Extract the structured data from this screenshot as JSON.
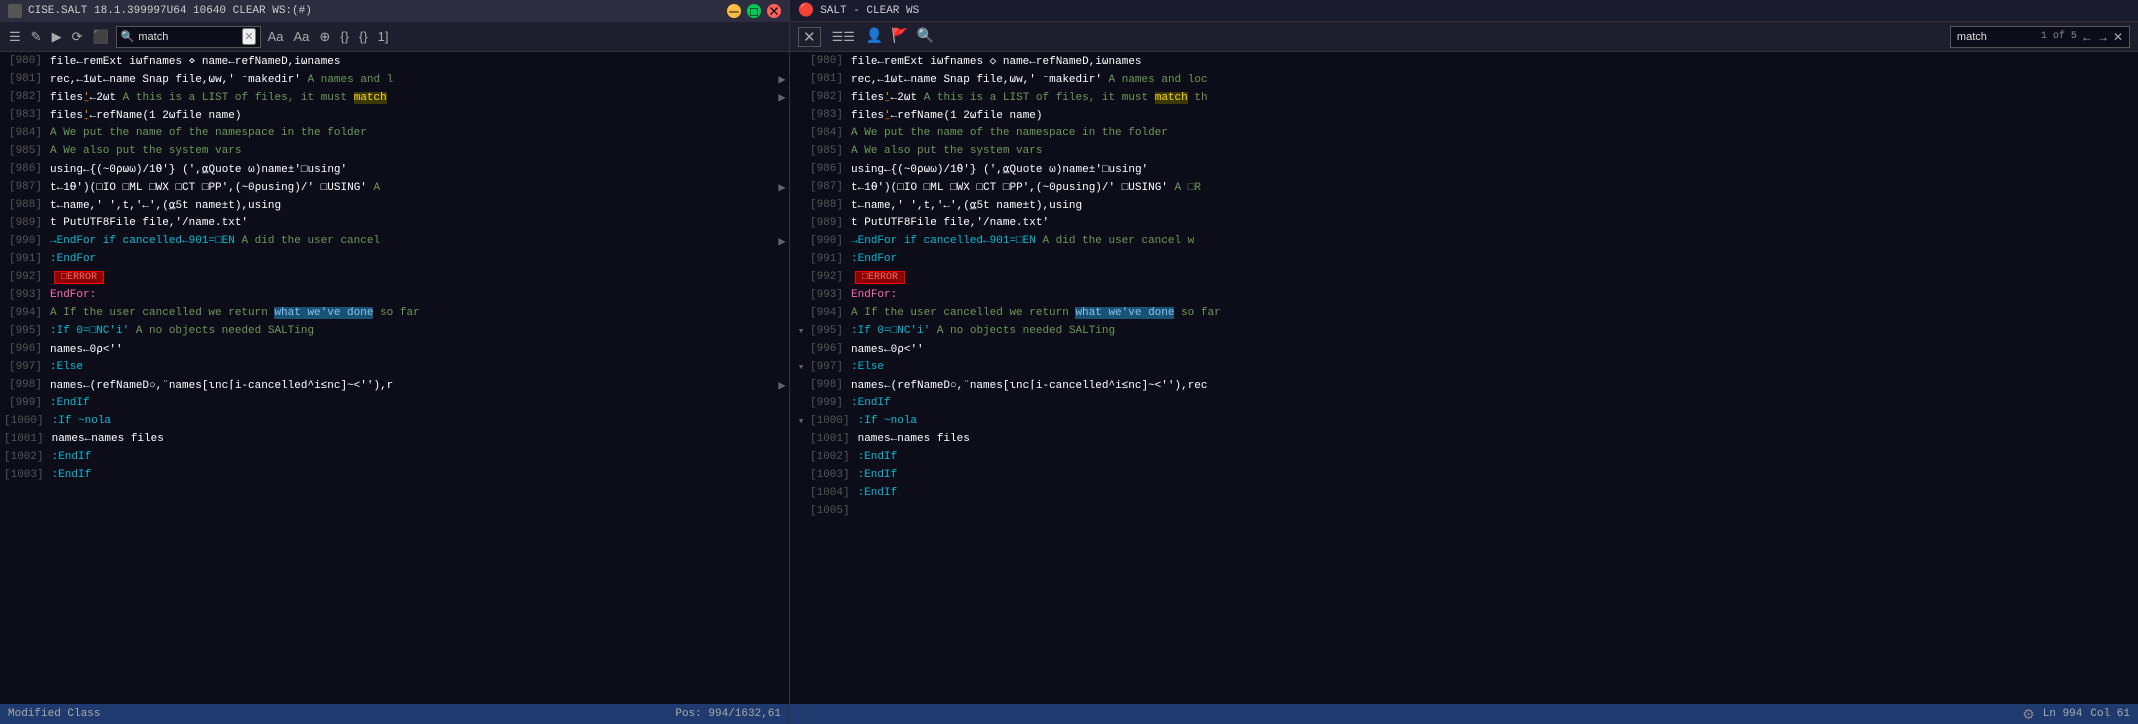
{
  "left": {
    "title": "CISE.SALT 18.1.399997U64 10640 CLEAR WS:(#)",
    "search_value": "match",
    "status_left": "Modified Class",
    "status_right": "Pos: 994/1632,61",
    "lines": [
      {
        "num": "980",
        "content": [
          {
            "t": "        file←remExt i⍵fnames ⋄ name←refNameD,i⍵names",
            "c": "kw-white"
          }
        ],
        "arrow": ""
      },
      {
        "num": "981",
        "content": [
          {
            "t": "        rec,←1⍵t←name Snap file,⍵w,' ⁻makedir' ",
            "c": "kw-white"
          },
          {
            "t": "A names and l",
            "c": "kw-comment"
          }
        ],
        "arrow": "▶"
      },
      {
        "num": "982",
        "content": [
          {
            "t": "        files",
            "c": "kw-white"
          },
          {
            "t": "⍘",
            "c": "kw-orange"
          },
          {
            "t": "←2⍵t ",
            "c": "kw-white"
          },
          {
            "t": "A this is a LIST of files, it must ",
            "c": "kw-comment"
          },
          {
            "t": "match",
            "c": "highlight-match"
          }
        ],
        "arrow": "▶"
      },
      {
        "num": "983",
        "content": [
          {
            "t": "        files",
            "c": "kw-white"
          },
          {
            "t": "⍘",
            "c": "kw-orange"
          },
          {
            "t": "←refName(1 2⍵file name)",
            "c": "kw-white"
          }
        ],
        "arrow": ""
      },
      {
        "num": "984",
        "content": [
          {
            "t": "        ",
            "c": "kw-white"
          },
          {
            "t": "A We put the name of the namespace in the folder",
            "c": "kw-comment"
          }
        ],
        "arrow": ""
      },
      {
        "num": "985",
        "content": [
          {
            "t": "        ",
            "c": "kw-white"
          },
          {
            "t": "A We also put the system vars",
            "c": "kw-comment"
          }
        ],
        "arrow": ""
      },
      {
        "num": "986",
        "content": [
          {
            "t": "        using←{(~0⍴⍵ω)/1⍬'} (',⍶Quote ω)name±'□using'",
            "c": "kw-white"
          }
        ],
        "arrow": ""
      },
      {
        "num": "987",
        "content": [
          {
            "t": "        t←1⍬')(□IO □ML □WX □CT □PP',(~0⍴using)/' □USING' ",
            "c": "kw-white"
          },
          {
            "t": "A ",
            "c": "kw-comment"
          }
        ],
        "arrow": "▶"
      },
      {
        "num": "988",
        "content": [
          {
            "t": "        t←name,' ',t,'←',(⍶5t name±t),using",
            "c": "kw-white"
          }
        ],
        "arrow": ""
      },
      {
        "num": "989",
        "content": [
          {
            "t": "        t PutUTF8File file,'/name.txt'",
            "c": "kw-white"
          }
        ],
        "arrow": ""
      },
      {
        "num": "990",
        "content": [
          {
            "t": "        ",
            "c": "kw-white"
          },
          {
            "t": "→EndFor if cancelled←901=□EN   ",
            "c": "kw-cyan"
          },
          {
            "t": "A did the user cancel ",
            "c": "kw-comment"
          }
        ],
        "arrow": "▶"
      },
      {
        "num": "991",
        "content": [
          {
            "t": "        :EndFor",
            "c": "kw-cyan"
          }
        ],
        "arrow": ""
      },
      {
        "num": "992",
        "content": [
          {
            "t": "        ",
            "c": "kw-white"
          },
          {
            "t": "□ERROR",
            "c": "error-badge"
          }
        ],
        "arrow": ""
      },
      {
        "num": "993",
        "content": [
          {
            "t": "    EndFor:",
            "c": "kw-pink"
          }
        ],
        "arrow": ""
      },
      {
        "num": "994",
        "content": [
          {
            "t": "        ",
            "c": "kw-white"
          },
          {
            "t": "A If the user cancelled we return ",
            "c": "kw-comment"
          },
          {
            "t": "what we've done",
            "c": "highlight-blue"
          },
          {
            "t": " so far",
            "c": "kw-comment"
          }
        ],
        "arrow": ""
      },
      {
        "num": "995",
        "content": [
          {
            "t": "        :If 0=□NC'i' ",
            "c": "kw-cyan"
          },
          {
            "t": "A no objects needed SALTing",
            "c": "kw-comment"
          }
        ],
        "arrow": ""
      },
      {
        "num": "996",
        "content": [
          {
            "t": "            names←0⍴<''",
            "c": "kw-white"
          }
        ],
        "arrow": ""
      },
      {
        "num": "997",
        "content": [
          {
            "t": "        :Else",
            "c": "kw-cyan"
          }
        ],
        "arrow": ""
      },
      {
        "num": "998",
        "content": [
          {
            "t": "            names←(refNameD○,¨names[ιnc⌈i-cancelled^i≤nc]~<''),r",
            "c": "kw-white"
          }
        ],
        "arrow": "▶"
      },
      {
        "num": "999",
        "content": [
          {
            "t": "        :EndIf",
            "c": "kw-cyan"
          }
        ],
        "arrow": ""
      },
      {
        "num": "1000",
        "content": [
          {
            "t": "        :If ~nola",
            "c": "kw-cyan"
          }
        ],
        "arrow": ""
      },
      {
        "num": "1001",
        "content": [
          {
            "t": "            names←names files",
            "c": "kw-white"
          }
        ],
        "arrow": ""
      },
      {
        "num": "1002",
        "content": [
          {
            "t": "        :EndIf",
            "c": "kw-cyan"
          }
        ],
        "arrow": ""
      },
      {
        "num": "1003",
        "content": [
          {
            "t": "    :EndIf",
            "c": "kw-cyan"
          }
        ],
        "arrow": ""
      }
    ]
  },
  "right": {
    "title": "SALT - CLEAR WS",
    "search_value": "match",
    "search_count": "1 of 5",
    "status_line": "Ln 994",
    "status_col": "Col 61",
    "lines": [
      {
        "num": "980",
        "content": [
          {
            "t": "        file←remExt i⍵fnames ◇ name←refNameD,i⍵names",
            "c": "kw-white"
          }
        ],
        "fold": ""
      },
      {
        "num": "981",
        "content": [
          {
            "t": "        rec,←1⍵t←name Snap file,⍵w,' ⁻makedir' ",
            "c": "kw-white"
          },
          {
            "t": "A names and loc",
            "c": "kw-comment"
          }
        ],
        "fold": ""
      },
      {
        "num": "982",
        "content": [
          {
            "t": "        files",
            "c": "kw-white"
          },
          {
            "t": "⍘",
            "c": "kw-orange"
          },
          {
            "t": "←2⍵t ",
            "c": "kw-white"
          },
          {
            "t": "A this is a LIST of files, it must ",
            "c": "kw-comment"
          },
          {
            "t": "match",
            "c": "highlight-match"
          },
          {
            "t": " th",
            "c": "kw-comment"
          }
        ],
        "fold": ""
      },
      {
        "num": "983",
        "content": [
          {
            "t": "        files",
            "c": "kw-white"
          },
          {
            "t": "⍘",
            "c": "kw-orange"
          },
          {
            "t": "←refName(1 2⍵file name)",
            "c": "kw-white"
          }
        ],
        "fold": ""
      },
      {
        "num": "984",
        "content": [
          {
            "t": "        ",
            "c": "kw-white"
          },
          {
            "t": "A We put the name of the namespace in the folder",
            "c": "kw-comment"
          }
        ],
        "fold": ""
      },
      {
        "num": "985",
        "content": [
          {
            "t": "        ",
            "c": "kw-white"
          },
          {
            "t": "A We also put the system vars",
            "c": "kw-comment"
          }
        ],
        "fold": ""
      },
      {
        "num": "986",
        "content": [
          {
            "t": "        using←{(~0⍴⍵ω)/1⍬'} (',⍶Quote ω)name±'□using'",
            "c": "kw-white"
          }
        ],
        "fold": ""
      },
      {
        "num": "987",
        "content": [
          {
            "t": "        t←1⍬')(□IO □ML □WX □CT □PP',(~0⍴using)/' □USING' ",
            "c": "kw-white"
          },
          {
            "t": "A □R",
            "c": "kw-comment"
          }
        ],
        "fold": ""
      },
      {
        "num": "988",
        "content": [
          {
            "t": "        t←name,' ',t,'←',(⍶5t name±t),using",
            "c": "kw-white"
          }
        ],
        "fold": ""
      },
      {
        "num": "989",
        "content": [
          {
            "t": "        t PutUTF8File file,'/name.txt'",
            "c": "kw-white"
          }
        ],
        "fold": ""
      },
      {
        "num": "990",
        "content": [
          {
            "t": "        ",
            "c": "kw-white"
          },
          {
            "t": "→EndFor if cancelled←901=□EN   ",
            "c": "kw-cyan"
          },
          {
            "t": "A did the user cancel w",
            "c": "kw-comment"
          }
        ],
        "fold": ""
      },
      {
        "num": "991",
        "content": [
          {
            "t": "        :EndFor",
            "c": "kw-cyan"
          }
        ],
        "fold": ""
      },
      {
        "num": "992",
        "content": [
          {
            "t": "        ",
            "c": "kw-white"
          },
          {
            "t": "□ERROR",
            "c": "error-badge"
          }
        ],
        "fold": ""
      },
      {
        "num": "993",
        "content": [
          {
            "t": "    EndFor:",
            "c": "kw-pink"
          }
        ],
        "fold": ""
      },
      {
        "num": "994",
        "content": [
          {
            "t": "        ",
            "c": "kw-white"
          },
          {
            "t": "A If the user cancelled we return ",
            "c": "kw-comment"
          },
          {
            "t": "what we've done",
            "c": "highlight-blue"
          },
          {
            "t": " so far",
            "c": "kw-comment"
          }
        ],
        "fold": ""
      },
      {
        "num": "995",
        "content": [
          {
            "t": "        :If 0=□NC'i' ",
            "c": "kw-cyan"
          },
          {
            "t": "A no objects needed SALTing",
            "c": "kw-comment"
          }
        ],
        "fold": "▾"
      },
      {
        "num": "996",
        "content": [
          {
            "t": "            names←0⍴<''",
            "c": "kw-white"
          }
        ],
        "fold": ""
      },
      {
        "num": "997",
        "content": [
          {
            "t": "        :Else",
            "c": "kw-cyan"
          }
        ],
        "fold": "▾"
      },
      {
        "num": "998",
        "content": [
          {
            "t": "            names←(refNameD○,¨names[ιnc⌈i-cancelled^i≤nc]~<''),rec",
            "c": "kw-white"
          }
        ],
        "fold": ""
      },
      {
        "num": "999",
        "content": [
          {
            "t": "        :EndIf",
            "c": "kw-cyan"
          }
        ],
        "fold": ""
      },
      {
        "num": "1000",
        "content": [
          {
            "t": "        :If ~nola",
            "c": "kw-cyan"
          }
        ],
        "fold": "▾"
      },
      {
        "num": "1001",
        "content": [
          {
            "t": "            names←names files",
            "c": "kw-white"
          }
        ],
        "fold": ""
      },
      {
        "num": "1002",
        "content": [
          {
            "t": "        :EndIf",
            "c": "kw-cyan"
          }
        ],
        "fold": ""
      },
      {
        "num": "1003",
        "content": [
          {
            "t": "    :EndIf",
            "c": "kw-cyan"
          }
        ],
        "fold": ""
      },
      {
        "num": "1004",
        "content": [
          {
            "t": "    :EndIf",
            "c": "kw-cyan"
          }
        ],
        "fold": ""
      },
      {
        "num": "1005",
        "content": [],
        "fold": ""
      }
    ]
  },
  "toolbar": {
    "buttons": [
      "≡",
      "≡",
      "▶",
      "≡",
      "⟳",
      "⬚",
      "Aa",
      "Aa",
      "⌖",
      "{}",
      "{}",
      "1]"
    ]
  }
}
